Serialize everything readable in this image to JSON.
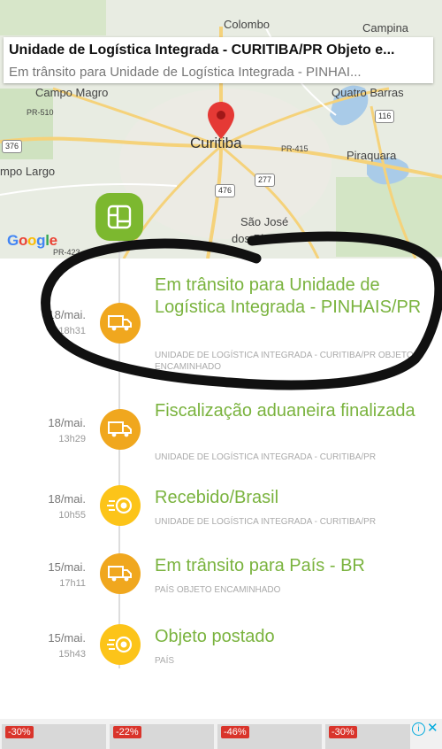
{
  "map": {
    "info_title": "Unidade de Logística Integrada - CURITIBA/PR Objeto e...",
    "info_subtitle": "Em trânsito para Unidade de Logística Integrada - PINHAI...",
    "labels": {
      "colombo": "Colombo",
      "campina": "Campina",
      "campo_magro": "Campo Magro",
      "quatro_barras": "Quatro Barras",
      "curitiba": "Curitiba",
      "piraquara": "Piraquara",
      "campo_largo": "mpo Largo",
      "sao_jose": "São José",
      "dos_pinhais": "dos Pinhais"
    },
    "roads": {
      "pr510": "PR-510",
      "r376": "376",
      "r116": "116",
      "pr415": "PR-415",
      "r277": "277",
      "r476": "476",
      "pr423": "PR-423"
    },
    "google": "Google"
  },
  "timeline": [
    {
      "date": "18/mai.",
      "time": "18h31",
      "title": "Em trânsito para Unidade de Logística Integrada - PINHAIS/PR",
      "subtitle": "UNIDADE DE LOGÍSTICA INTEGRADA - CURITIBA/PR OBJETO ENCAMINHADO",
      "icon": "truck-icon",
      "color": "#f0a71e"
    },
    {
      "date": "18/mai.",
      "time": "13h29",
      "title": "Fiscalização aduaneira finalizada",
      "subtitle": "UNIDADE DE LOGÍSTICA INTEGRADA - CURITIBA/PR",
      "icon": "truck-icon",
      "color": "#f0a71e"
    },
    {
      "date": "18/mai.",
      "time": "10h55",
      "title": "Recebido/Brasil",
      "subtitle": "UNIDADE DE LOGÍSTICA INTEGRADA - CURITIBA/PR",
      "icon": "received-icon",
      "color": "#fcc419"
    },
    {
      "date": "15/mai.",
      "time": "17h11",
      "title": "Em trânsito para País - BR",
      "subtitle": "PAÍS OBJETO ENCAMINHADO",
      "icon": "truck-icon",
      "color": "#f0a71e"
    },
    {
      "date": "15/mai.",
      "time": "15h43",
      "title": "Objeto postado",
      "subtitle": "PAÍS",
      "icon": "received-icon",
      "color": "#fcc419"
    }
  ],
  "ad": {
    "discounts": [
      "-30%",
      "-22%",
      "-46%",
      "-30%"
    ],
    "info": "i",
    "close": "✕"
  }
}
